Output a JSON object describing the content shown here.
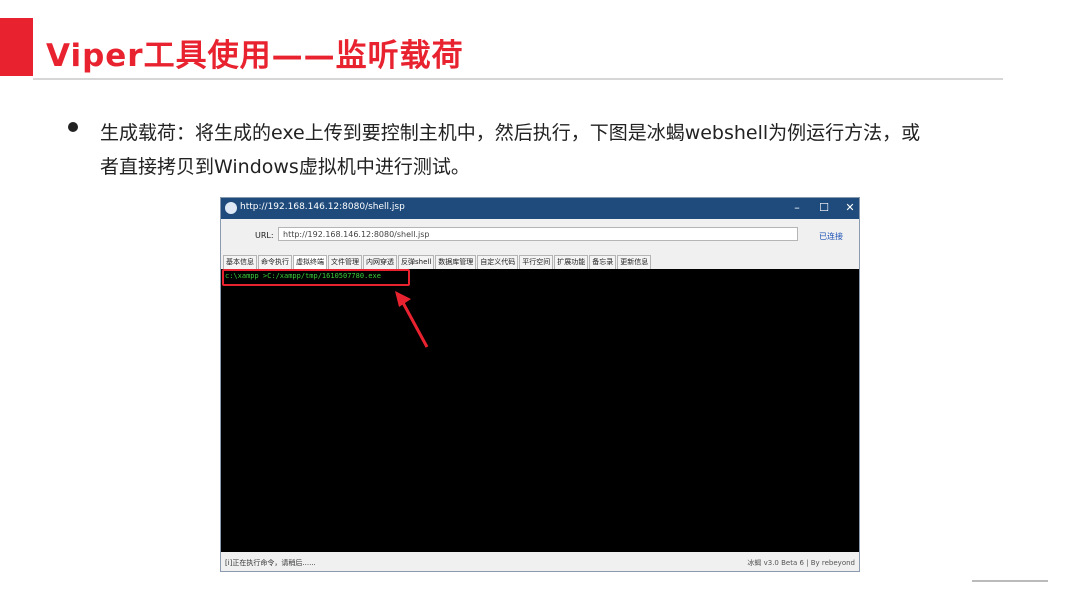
{
  "slide": {
    "title": "Viper工具使用——监听载荷",
    "bullet_line1": "生成载荷：将生成的exe上传到要控制主机中，然后执行，下图是冰蝎webshell为例运行方法，或",
    "bullet_line2": "者直接拷贝到Windows虚拟机中进行测试。"
  },
  "window": {
    "title": "http://192.168.146.12:8080/shell.jsp",
    "minimize": "–",
    "maximize": "☐",
    "close": "✕",
    "url_label": "URL:",
    "url_value": "http://192.168.146.12:8080/shell.jsp",
    "connect_label": "已连接",
    "tabs": [
      "基本信息",
      "命令执行",
      "虚拟终端",
      "文件管理",
      "内网穿透",
      "反弹shell",
      "数据库管理",
      "自定义代码",
      "平行空间",
      "扩展功能",
      "备忘录",
      "更新信息"
    ],
    "terminal_prompt": "c:\\xampp >C:/xampp/tmp/1610507780.exe",
    "status_left": "[i]正在执行命令，请稍后......",
    "status_right": "冰蝎 v3.0 Beta 6 | By rebeyond"
  },
  "colors": {
    "accent": "#e8232f",
    "titlebar": "#1e4b7c",
    "terminal_bg": "#000000",
    "terminal_text": "#3ccf3c"
  }
}
